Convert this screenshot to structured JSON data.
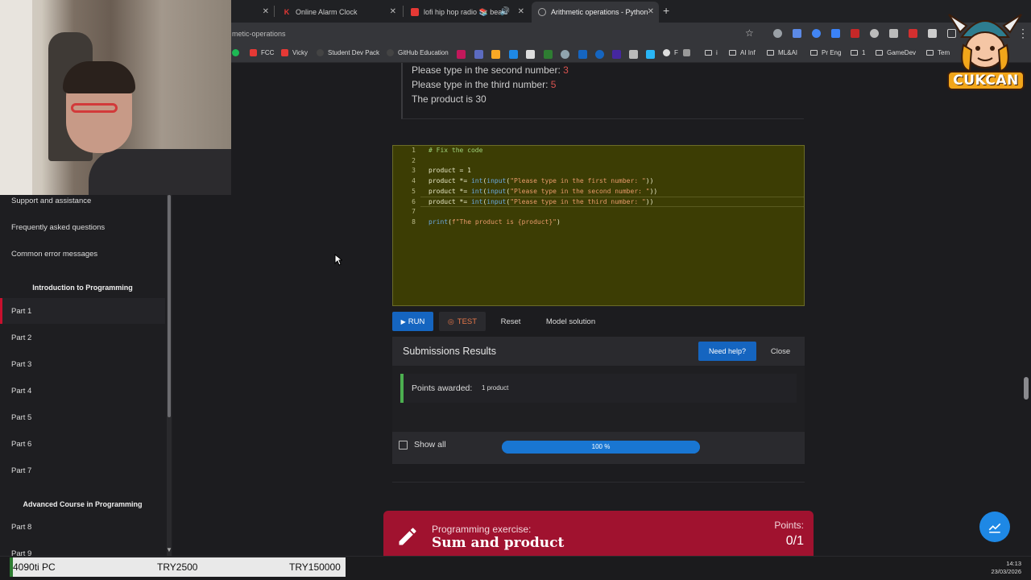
{
  "browser": {
    "tabs": [
      {
        "label": "Online Alarm Clock",
        "icon": "k-logo-icon"
      },
      {
        "label": "lofi hip hop radio 📚 beats",
        "icon": "youtube-icon"
      },
      {
        "label": "Arithmetic operations - Python",
        "icon": "globe-icon"
      }
    ],
    "url": "metic-operations",
    "bookmarks": [
      "FCC",
      "Vicky",
      "Student Dev Pack",
      "GitHub Education",
      "F",
      "i",
      "AI Inf",
      "ML&AI",
      "Pr Eng",
      "1",
      "GameDev",
      "Tem"
    ]
  },
  "logo": {
    "text": "CUKCAN"
  },
  "output": {
    "line1_label": "Please type in the second number:",
    "line1_value": "3",
    "line2_label": "Please type in the third number:",
    "line2_value": "5",
    "line3": "The product is 30"
  },
  "editor": {
    "line_numbers": [
      "1",
      "2",
      "3",
      "4",
      "5",
      "6",
      "7",
      "8"
    ],
    "lines": [
      {
        "parts": [
          {
            "t": "# Fix the code",
            "c": "c-com"
          }
        ]
      },
      {
        "parts": []
      },
      {
        "parts": [
          {
            "t": "product = 1",
            "c": ""
          }
        ]
      },
      {
        "parts": [
          {
            "t": "product *= ",
            "c": ""
          },
          {
            "t": "int",
            "c": "c-fn"
          },
          {
            "t": "(",
            "c": ""
          },
          {
            "t": "input",
            "c": "c-fn"
          },
          {
            "t": "(",
            "c": ""
          },
          {
            "t": "\"Please type in the first number: \"",
            "c": "c-str"
          },
          {
            "t": "))",
            "c": ""
          }
        ]
      },
      {
        "parts": [
          {
            "t": "product *= ",
            "c": ""
          },
          {
            "t": "int",
            "c": "c-fn"
          },
          {
            "t": "(",
            "c": ""
          },
          {
            "t": "input",
            "c": "c-fn"
          },
          {
            "t": "(",
            "c": ""
          },
          {
            "t": "\"Please type in the second number: \"",
            "c": "c-str"
          },
          {
            "t": "))",
            "c": ""
          }
        ]
      },
      {
        "parts": [
          {
            "t": "product *= ",
            "c": ""
          },
          {
            "t": "int",
            "c": "c-fn"
          },
          {
            "t": "(",
            "c": ""
          },
          {
            "t": "input",
            "c": "c-fn"
          },
          {
            "t": "(",
            "c": ""
          },
          {
            "t": "\"Please type in the third number: \"",
            "c": "c-str"
          },
          {
            "t": "))",
            "c": ""
          }
        ]
      },
      {
        "parts": []
      },
      {
        "parts": [
          {
            "t": "print",
            "c": "c-fn"
          },
          {
            "t": "(",
            "c": ""
          },
          {
            "t": "f\"The product is {product}\"",
            "c": "c-str"
          },
          {
            "t": ")",
            "c": ""
          }
        ]
      }
    ]
  },
  "buttons": {
    "run": "RUN",
    "test": "TEST",
    "reset": "Reset",
    "model": "Model solution"
  },
  "results": {
    "title": "Submissions Results",
    "need_help": "Need help?",
    "close": "Close",
    "points_label": "Points awarded:",
    "points_value": "1 product",
    "show_all": "Show all",
    "progress_text": "100 %",
    "progress": 1.0
  },
  "sidebar": {
    "items_top": [
      "Support and assistance",
      "Frequently asked questions",
      "Common error messages"
    ],
    "heading1": "Introduction to Programming",
    "parts1": [
      "Part 1",
      "Part 2",
      "Part 3",
      "Part 4",
      "Part 5",
      "Part 6",
      "Part 7"
    ],
    "heading2": "Advanced Course in Programming",
    "parts2": [
      "Part 8",
      "Part 9"
    ]
  },
  "next_exercise": {
    "subtitle": "Programming exercise:",
    "title": "Sum and product",
    "points_label": "Points:",
    "points_value": "0/1"
  },
  "taskbar": {
    "stock_name": "4090ti PC",
    "price1": "TRY2500",
    "price2": "TRY150000",
    "time": "14:13",
    "date": "23/03/2026"
  },
  "colors": {
    "accent": "#1565c0",
    "brand_red": "#a0122f",
    "success": "#4caf50",
    "editor_bg": "#3c3d04"
  }
}
